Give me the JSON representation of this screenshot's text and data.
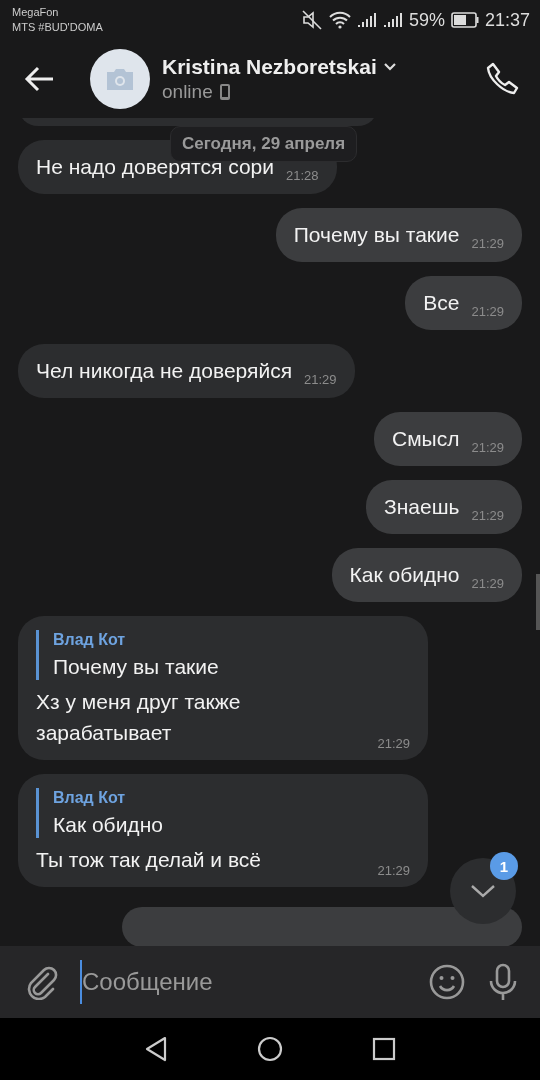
{
  "status_bar": {
    "carrier_lines": [
      "MegaFon",
      "MTS #BUD'DOMA"
    ],
    "battery": "59%",
    "time": "21:37"
  },
  "header": {
    "name": "Kristina Nezboretskai",
    "status": "online"
  },
  "date_pill": "Сегодня, 29 апреля",
  "messages": [
    {
      "kind": "incoming",
      "text": "Не надо доверятся сори",
      "time": "21:28"
    },
    {
      "kind": "outgoing",
      "text": "Почему вы такие",
      "time": "21:29"
    },
    {
      "kind": "outgoing",
      "text": "Все",
      "time": "21:29"
    },
    {
      "kind": "incoming",
      "text": "Чел никогда не доверяйся",
      "time": "21:29"
    },
    {
      "kind": "outgoing",
      "text": "Смысл",
      "time": "21:29"
    },
    {
      "kind": "outgoing",
      "text": "Знаешь",
      "time": "21:29"
    },
    {
      "kind": "outgoing",
      "text": "Как обидно",
      "time": "21:29"
    },
    {
      "kind": "incoming",
      "reply": {
        "author": "Влад Кот",
        "text": "Почему вы такие"
      },
      "text": "Хз у меня друг также зарабатывает",
      "time": "21:29"
    },
    {
      "kind": "incoming",
      "reply": {
        "author": "Влад Кот",
        "text": "Как обидно"
      },
      "text": "Ты тож так делай и всё",
      "time": "21:29"
    }
  ],
  "scroll_button": {
    "badge": "1"
  },
  "composer": {
    "placeholder": "Сообщение"
  }
}
